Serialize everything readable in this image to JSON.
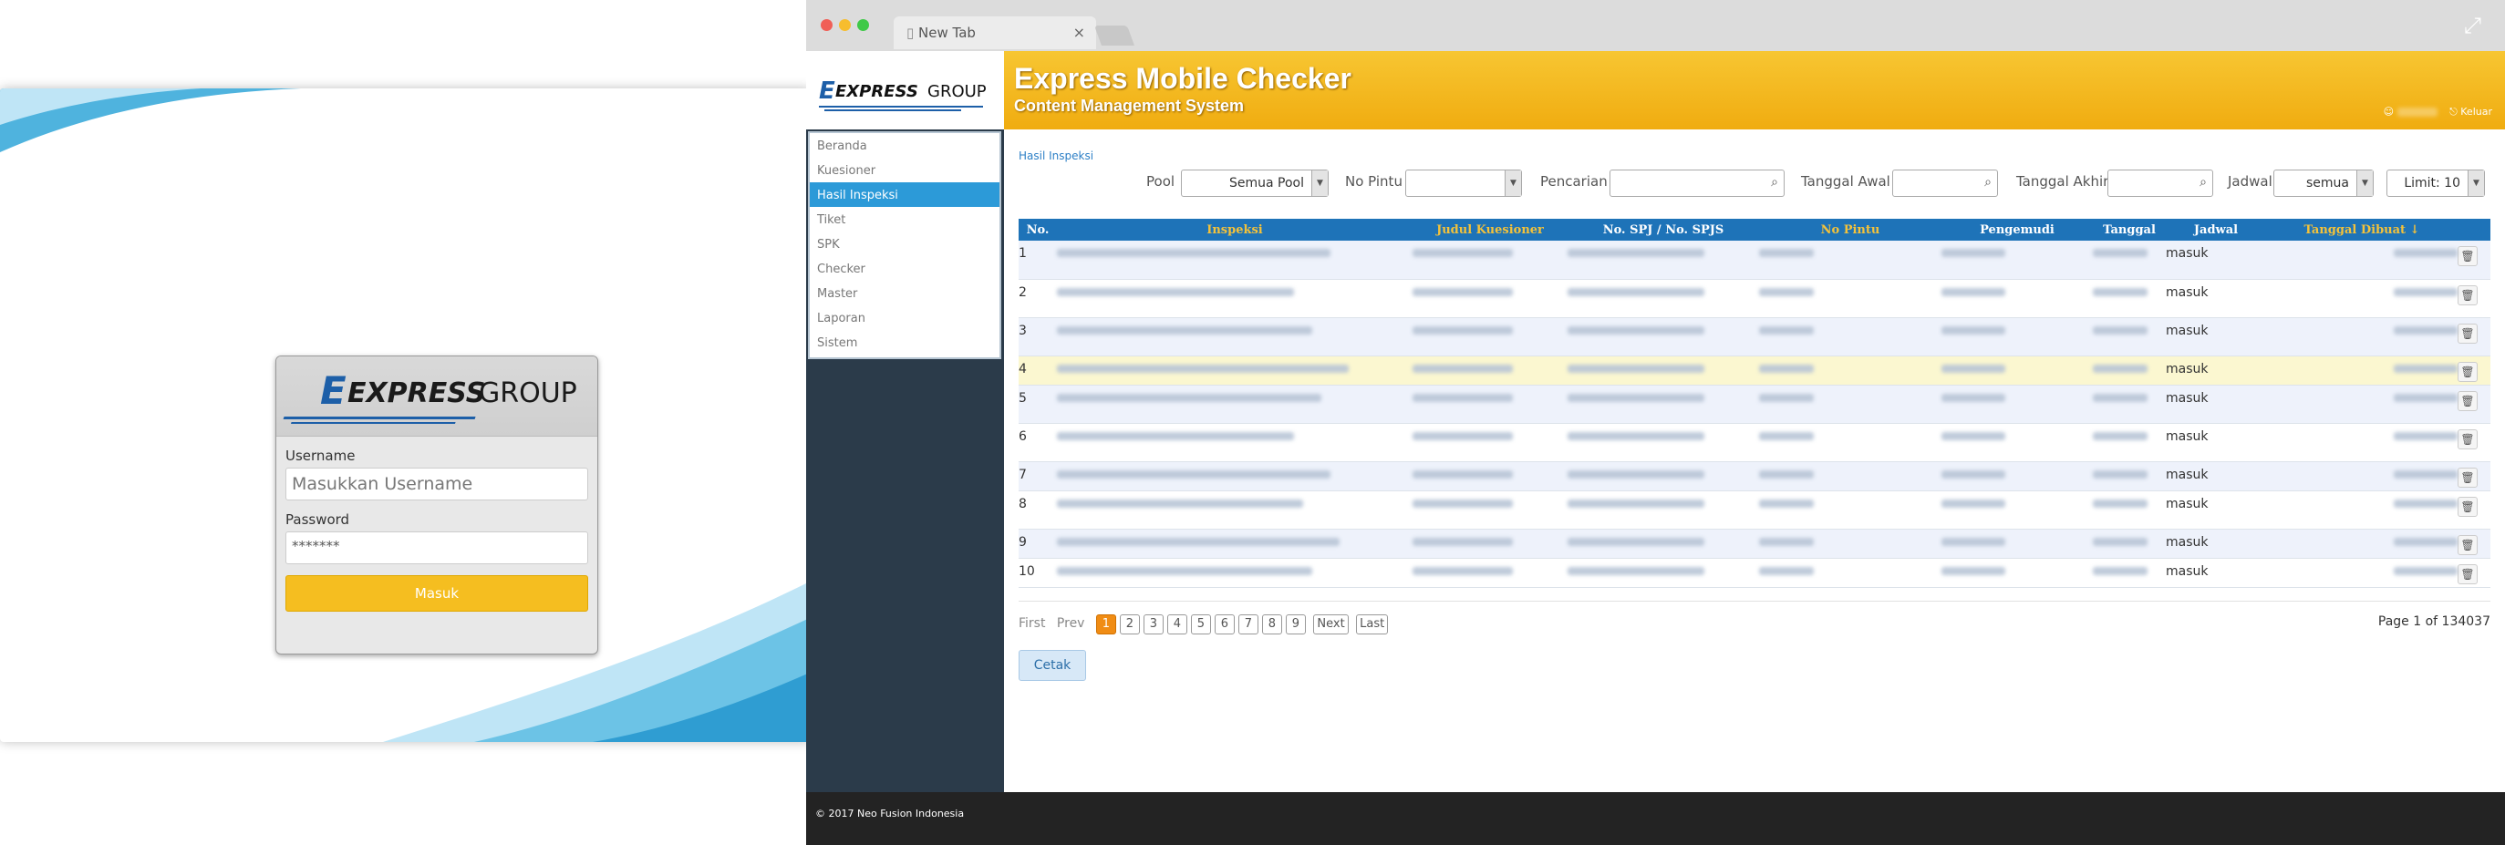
{
  "login": {
    "brand_express": "EXPRESS",
    "brand_group": "GROUP",
    "username_label": "Username",
    "username_placeholder": "Masukkan Username",
    "password_label": "Password",
    "password_value": "*******",
    "submit_label": "Masuk"
  },
  "browser": {
    "tab_title": "New Tab",
    "tab_close": "×",
    "expand_icon": "⤢"
  },
  "app": {
    "title": "Express Mobile Checker",
    "subtitle": "Content Management System",
    "logout_label": "Keluar",
    "footer": "© 2017 Neo Fusion Indonesia"
  },
  "sidebar": {
    "items": [
      {
        "label": "Beranda"
      },
      {
        "label": "Kuesioner"
      },
      {
        "label": "Hasil Inspeksi"
      },
      {
        "label": "Tiket"
      },
      {
        "label": "SPK"
      },
      {
        "label": "Checker"
      },
      {
        "label": "Master"
      },
      {
        "label": "Laporan"
      },
      {
        "label": "Sistem"
      }
    ]
  },
  "content": {
    "breadcrumb": "Hasil Inspeksi",
    "filters": {
      "pool_label": "Pool",
      "pool_value": "Semua Pool",
      "nopintu_label": "No Pintu",
      "pencarian_label": "Pencarian",
      "tanggal_awal_label": "Tanggal Awal",
      "tanggal_akhir_label": "Tanggal Akhir",
      "jadwal_label": "Jadwal",
      "jadwal_value": "semua",
      "limit_value": "Limit: 10"
    },
    "columns": [
      "No.",
      "Inspeksi",
      "Judul Kuesioner",
      "No. SPJ / No. SPJS",
      "No Pintu",
      "Pengemudi",
      "Tanggal",
      "Jadwal",
      "Tanggal Dibuat ↓"
    ],
    "rows": [
      {
        "no": "1",
        "jadwal": "masuk"
      },
      {
        "no": "2",
        "jadwal": "masuk"
      },
      {
        "no": "3",
        "jadwal": "masuk"
      },
      {
        "no": "4",
        "jadwal": "masuk"
      },
      {
        "no": "5",
        "jadwal": "masuk"
      },
      {
        "no": "6",
        "jadwal": "masuk"
      },
      {
        "no": "7",
        "jadwal": "masuk"
      },
      {
        "no": "8",
        "jadwal": "masuk"
      },
      {
        "no": "9",
        "jadwal": "masuk"
      },
      {
        "no": "10",
        "jadwal": "masuk"
      }
    ],
    "pager": {
      "first": "First",
      "prev": "Prev",
      "pages": [
        "1",
        "2",
        "3",
        "4",
        "5",
        "6",
        "7",
        "8",
        "9"
      ],
      "current": "1",
      "next": "Next",
      "last": "Last",
      "info": "Page 1 of 134037"
    },
    "print_label": "Cetak"
  },
  "colors": {
    "accent_yellow": "#f5be20",
    "header_blue": "#1e73b8",
    "active_menu": "#2c9ad8",
    "sidebar_dark": "#2b3b4a"
  }
}
